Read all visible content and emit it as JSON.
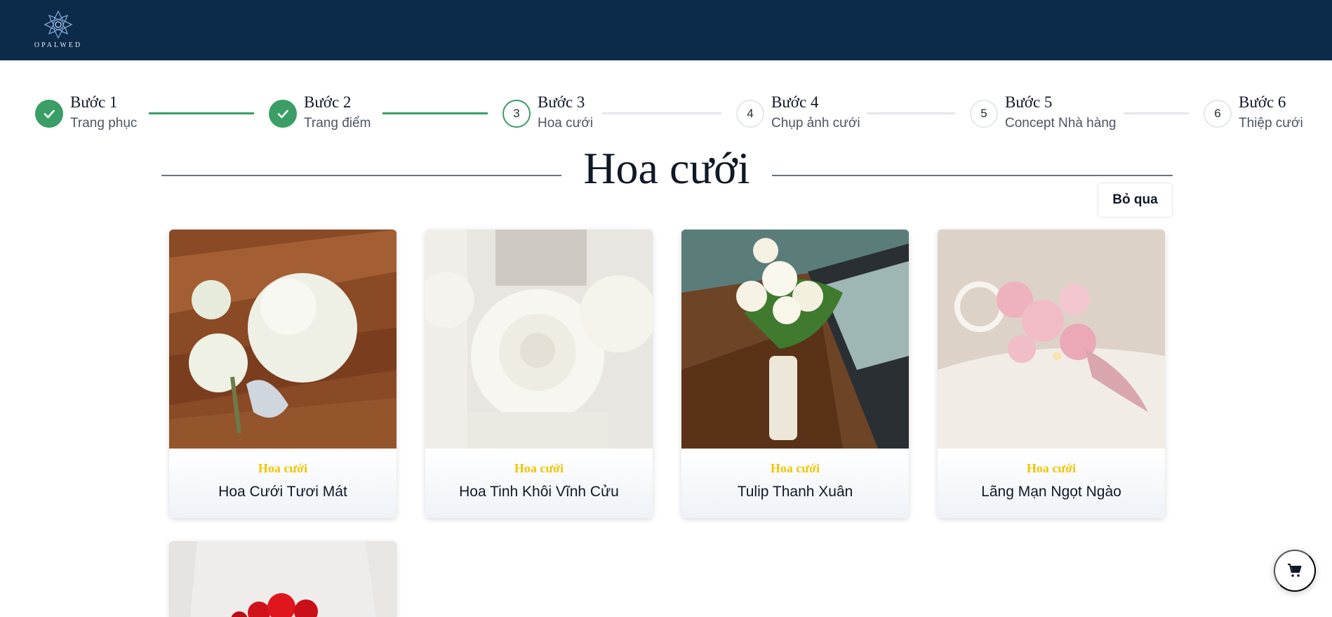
{
  "brand": {
    "logo_text": "OPALWED"
  },
  "stepper": {
    "steps": [
      {
        "title": "Bước 1",
        "subtitle": "Trang phục",
        "number": "1",
        "state": "done"
      },
      {
        "title": "Bước 2",
        "subtitle": "Trang điểm",
        "number": "2",
        "state": "done"
      },
      {
        "title": "Bước 3",
        "subtitle": "Hoa cưới",
        "number": "3",
        "state": "active"
      },
      {
        "title": "Bước 4",
        "subtitle": "Chụp ảnh cưới",
        "number": "4",
        "state": "todo"
      },
      {
        "title": "Bước 5",
        "subtitle": "Concept Nhà hàng",
        "number": "5",
        "state": "todo"
      },
      {
        "title": "Bước 6",
        "subtitle": "Thiệp cưới",
        "number": "6",
        "state": "todo"
      }
    ]
  },
  "page": {
    "title": "Hoa cưới",
    "skip_label": "Bỏ qua"
  },
  "products": [
    {
      "category": "Hoa cưới",
      "name": "Hoa Cưới Tươi Mát"
    },
    {
      "category": "Hoa cưới",
      "name": "Hoa Tinh Khôi Vĩnh Cửu"
    },
    {
      "category": "Hoa cưới",
      "name": "Tulip Thanh Xuân"
    },
    {
      "category": "Hoa cưới",
      "name": "Lãng Mạn Ngọt Ngào"
    }
  ],
  "colors": {
    "header_bg": "#0c2a49",
    "step_done": "#3a9e66",
    "category_text": "#f2c400"
  },
  "icons": {
    "step_done": "check-icon",
    "cart": "cart-icon"
  }
}
